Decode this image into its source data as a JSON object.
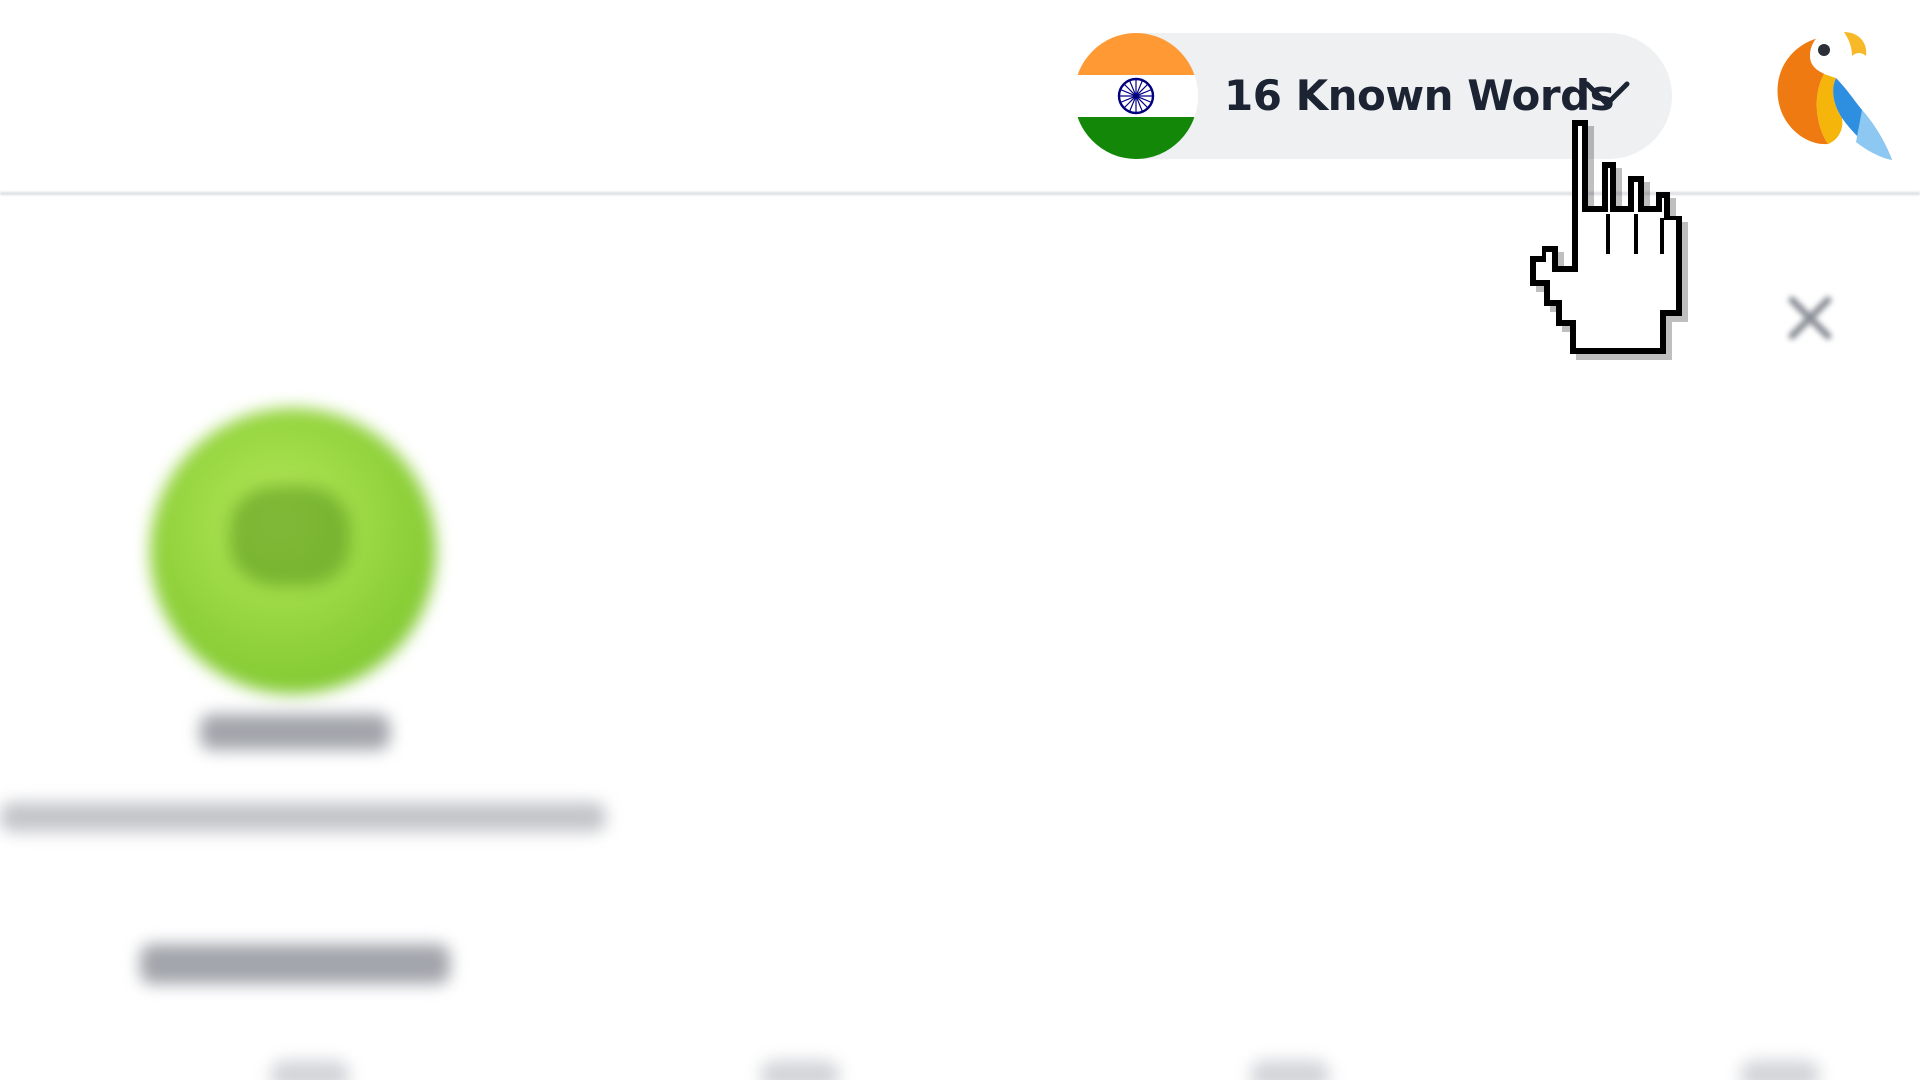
{
  "header": {
    "language_flag": "india-flag-icon",
    "known_words_label": "16 Known Words",
    "dropdown_icon": "chevron-down-icon",
    "logo_icon": "parrot-logo-icon"
  },
  "modal": {
    "close_icon": "close-icon"
  },
  "cursor": {
    "icon": "hand-pointer-cursor-icon"
  },
  "colors": {
    "saffron": "#FF9933",
    "white": "#FFFFFF",
    "green": "#138808",
    "chakra_blue": "#000080",
    "pill_background": "#EEF0F2",
    "text_dark": "#1C2433",
    "avatar_green": "#8FD13A"
  }
}
